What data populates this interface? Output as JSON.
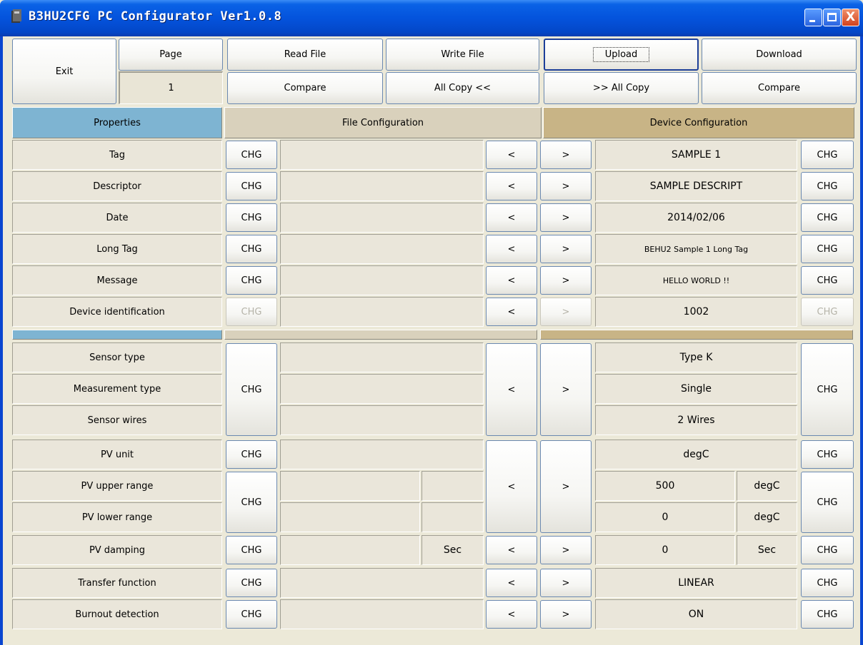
{
  "window": {
    "title": "B3HU2CFG PC Configurator Ver1.0.8",
    "close_glyph": "X"
  },
  "toolbar": {
    "exit": "Exit",
    "page_label": "Page",
    "page_number": "1",
    "read_file": "Read File",
    "write_file": "Write File",
    "upload": "Upload",
    "download": "Download",
    "compare_file": "Compare",
    "all_copy_left": "All Copy <<",
    "all_copy_right": ">> All Copy",
    "compare_device": "Compare"
  },
  "headers": {
    "properties": "Properties",
    "file": "File Configuration",
    "device": "Device Configuration"
  },
  "glyphs": {
    "chg": "CHG",
    "left": "<",
    "right": ">"
  },
  "rows": {
    "tag": {
      "label": "Tag",
      "device_value": "SAMPLE 1"
    },
    "descriptor": {
      "label": "Descriptor",
      "device_value": "SAMPLE DESCRIPT"
    },
    "date": {
      "label": "Date",
      "device_value": "2014/02/06"
    },
    "long_tag": {
      "label": "Long Tag",
      "device_value": "BEHU2 Sample 1 Long Tag"
    },
    "message": {
      "label": "Message",
      "device_value": "HELLO WORLD !!"
    },
    "device_id": {
      "label": "Device identification",
      "device_value": "1002"
    },
    "sensor_type": {
      "label": "Sensor type",
      "device_value": "Type K"
    },
    "meas_type": {
      "label": "Measurement type",
      "device_value": "Single"
    },
    "sensor_wires": {
      "label": "Sensor wires",
      "device_value": "2 Wires"
    },
    "pv_unit": {
      "label": "PV unit",
      "device_value": "degC"
    },
    "pv_upper": {
      "label": "PV upper range",
      "device_value": "500",
      "device_unit": "degC"
    },
    "pv_lower": {
      "label": "PV lower range",
      "device_value": "0",
      "device_unit": "degC"
    },
    "pv_damping": {
      "label": "PV damping",
      "file_unit": "Sec",
      "device_value": "0",
      "device_unit": "Sec"
    },
    "transfer": {
      "label": "Transfer function",
      "device_value": "LINEAR"
    },
    "burnout": {
      "label": "Burnout detection",
      "device_value": "ON"
    }
  },
  "disabled": [
    "device_id.file_chg",
    "device_id.copy_right",
    "device_id.device_chg"
  ],
  "colors": {
    "properties_header": "#7EB4D2",
    "file_header": "#D9D1BC",
    "device_header": "#C8B486",
    "titlebar": "#0453DC"
  }
}
